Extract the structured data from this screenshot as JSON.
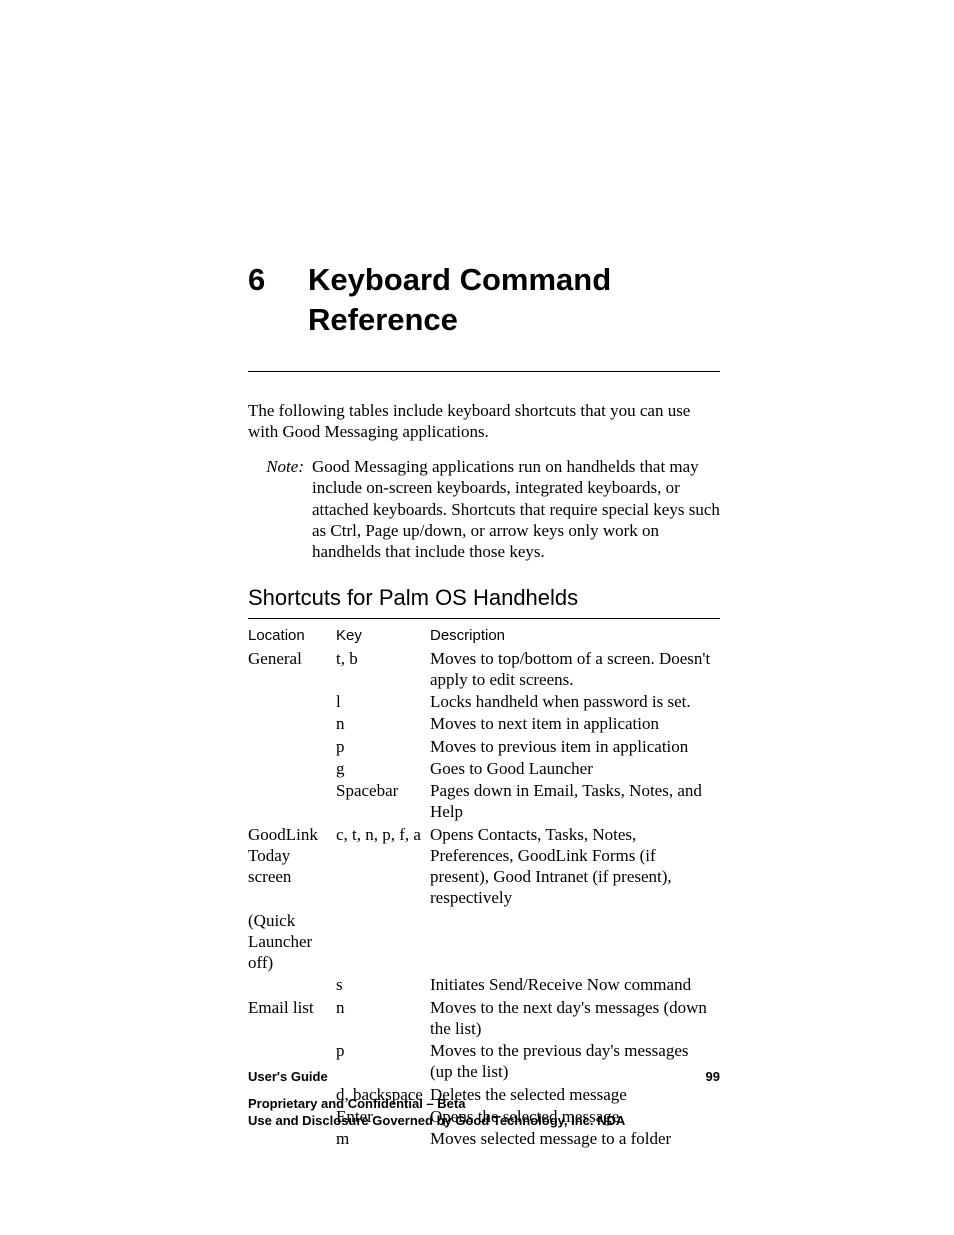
{
  "chapter": {
    "number": "6",
    "title": "Keyboard Command Reference"
  },
  "intro": "The following tables include keyboard shortcuts that you can use with Good Messaging applications.",
  "note": {
    "label": "Note:",
    "body": "Good Messaging applications run on handhelds that may include on-screen keyboards, integrated keyboards, or attached keyboards. Shortcuts that require special keys such as Ctrl, Page up/down, or arrow keys only work on handhelds that include those keys."
  },
  "section_title": "Shortcuts for Palm OS Handhelds",
  "table": {
    "headers": {
      "location": "Location",
      "key": "Key",
      "description": "Description"
    },
    "rows": [
      {
        "location": "General",
        "key": "t, b",
        "description": "Moves to top/bottom of a screen. Doesn't apply to edit screens."
      },
      {
        "location": "",
        "key": "l",
        "description": "Locks handheld when password is set."
      },
      {
        "location": "",
        "key": "n",
        "description": "Moves to next item in application"
      },
      {
        "location": "",
        "key": "p",
        "description": "Moves to previous item in application"
      },
      {
        "location": "",
        "key": "g",
        "description": "Goes to Good Launcher"
      },
      {
        "location": "",
        "key": "Spacebar",
        "description": "Pages down in Email, Tasks, Notes, and Help"
      },
      {
        "location": "GoodLink Today screen",
        "key": "c, t, n, p, f, a",
        "description": "Opens Contacts, Tasks, Notes, Preferences, GoodLink Forms (if present), Good Intranet (if present), respectively"
      },
      {
        "location": "(Quick Launcher off)",
        "key": "",
        "description": ""
      },
      {
        "location": "",
        "key": "s",
        "description": "Initiates Send/Receive Now command"
      },
      {
        "location": "Email list",
        "key": "n",
        "description": "Moves to the next day's messages (down the list)"
      },
      {
        "location": "",
        "key": "p",
        "description": "Moves to the previous day's messages (up the list)"
      },
      {
        "location": "",
        "key": "d, backspace",
        "description": "Deletes the selected message"
      },
      {
        "location": "",
        "key": "Enter",
        "description": "Opens the selected message"
      },
      {
        "location": "",
        "key": "m",
        "description": "Moves selected message to a folder"
      }
    ]
  },
  "footer": {
    "doc": "User's Guide",
    "page": "99"
  },
  "legal": {
    "line1": "Proprietary and Confidential – Beta",
    "line2": "Use and Disclosure Governed by Good Technology, Inc. NDA"
  }
}
